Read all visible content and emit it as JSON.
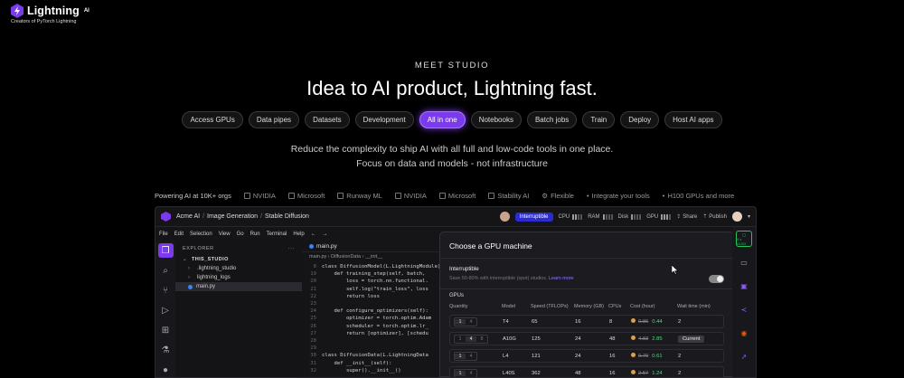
{
  "header": {
    "brand_name": "Lightning",
    "brand_suffix": "AI",
    "tagline": "Creators of PyTorch Lightning"
  },
  "hero": {
    "eyebrow": "MEET STUDIO",
    "headline": "Idea to AI product, Lightning fast.",
    "description_line1": "Reduce the complexity to ship AI with all full and low-code tools in one place.",
    "description_line2": "Focus on data and models - not infrastructure"
  },
  "pills": [
    {
      "label": "Access GPUs",
      "active": false
    },
    {
      "label": "Data pipes",
      "active": false
    },
    {
      "label": "Datasets",
      "active": false
    },
    {
      "label": "Development",
      "active": false
    },
    {
      "label": "All in one",
      "active": true
    },
    {
      "label": "Notebooks",
      "active": false
    },
    {
      "label": "Batch jobs",
      "active": false
    },
    {
      "label": "Train",
      "active": false
    },
    {
      "label": "Deploy",
      "active": false
    },
    {
      "label": "Host AI apps",
      "active": false
    }
  ],
  "powered": {
    "lead": "Powering AI at 10K+ orgs",
    "brands": [
      "NVIDIA",
      "Microsoft",
      "Runway ML",
      "NVIDIA",
      "Microsoft",
      "Stability AI"
    ],
    "features": [
      "Flexible",
      "Integrate your tools",
      "H100 GPUs and more"
    ]
  },
  "studio": {
    "breadcrumb": [
      "Acme AI",
      "Image Generation",
      "Stable Diffusion"
    ],
    "interruptible_tag": "Interruptible",
    "meters": [
      "CPU",
      "RAM",
      "Disk",
      "GPU"
    ],
    "share_label": "Share",
    "publish_label": "Publish",
    "menu": [
      "File",
      "Edit",
      "Selection",
      "View",
      "Go",
      "Run",
      "Terminal",
      "Help"
    ],
    "explorer_title": "EXPLORER",
    "explorer_more": "···",
    "tree": [
      {
        "label": "THIS_STUDIO",
        "type": "root"
      },
      {
        "label": ".lightning_studio",
        "type": "folder"
      },
      {
        "label": "lightning_logs",
        "type": "folder"
      },
      {
        "label": "main.py",
        "type": "file"
      }
    ],
    "editor_tab": "main.py",
    "editor_breadcrumb": "main.py › DiffusionData › __init__",
    "code_lines": [
      {
        "n": "8",
        "text": "class DiffusionModel(L.LightningModule):"
      },
      {
        "n": "19",
        "text": "    def training_step(self, batch, "
      },
      {
        "n": "20",
        "text": "        loss = torch.nn.functional."
      },
      {
        "n": "21",
        "text": "        self.log(\"train_loss\", loss"
      },
      {
        "n": "22",
        "text": "        return loss"
      },
      {
        "n": "23",
        "text": ""
      },
      {
        "n": "24",
        "text": "    def configure_optimizers(self):"
      },
      {
        "n": "25",
        "text": "        optimizer = torch.optim.Adam"
      },
      {
        "n": "26",
        "text": "        scheduler = torch.optim.lr_"
      },
      {
        "n": "27",
        "text": "        return [optimizer], [schedu"
      },
      {
        "n": "28",
        "text": ""
      },
      {
        "n": "29",
        "text": ""
      },
      {
        "n": "30",
        "text": "class DiffusionData(L.LightningData"
      },
      {
        "n": "31",
        "text": "    def __init__(self):"
      },
      {
        "n": "32",
        "text": "        super().__init__()"
      }
    ]
  },
  "gpu_modal": {
    "title": "Choose a GPU machine",
    "interruptible_title": "Interruptible",
    "interruptible_desc": "Save 50-80% with interruptible (spot) studios.",
    "learn_more": "Learn more",
    "gpus_label": "GPUs",
    "columns": [
      "Quantity",
      "Model",
      "Speed (TFLOPs)",
      "Memory (GB)",
      "CPUs",
      "Cost (hour)",
      "Wait time (min)"
    ],
    "rows": [
      {
        "qty": [
          "1",
          "4"
        ],
        "cur": 0,
        "model": "T4",
        "speed": "65",
        "memory": "16",
        "cpus": "8",
        "old_cost": "0.86",
        "new_cost": "0.44",
        "wait": "2",
        "current": false
      },
      {
        "qty": [
          "1",
          "4",
          "8"
        ],
        "cur": 1,
        "model": "A10G",
        "speed": "125",
        "memory": "24",
        "cpus": "48",
        "old_cost": "4.83",
        "new_cost": "2.85",
        "wait": "",
        "current": true,
        "current_label": "Current"
      },
      {
        "qty": [
          "1",
          "4"
        ],
        "cur": 0,
        "model": "L4",
        "speed": "121",
        "memory": "24",
        "cpus": "16",
        "old_cost": "0.70",
        "new_cost": "0.61",
        "wait": "2",
        "current": false
      },
      {
        "qty": [
          "1",
          "4"
        ],
        "cur": 0,
        "model": "L40S",
        "speed": "362",
        "memory": "48",
        "cpus": "16",
        "old_cost": "2.57",
        "new_cost": "1.24",
        "wait": "2",
        "current": false
      }
    ]
  },
  "rightbar": {
    "active_label": "4 x A10G"
  },
  "colors": {
    "accent": "#7c3aed",
    "green": "#22c55e"
  }
}
